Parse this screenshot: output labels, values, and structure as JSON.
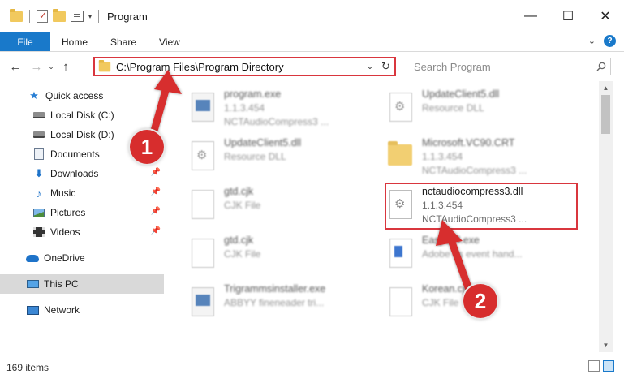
{
  "window": {
    "title": "Program",
    "minimize": "—",
    "maximize": "☐",
    "close": "✕"
  },
  "ribbon": {
    "tabs": [
      "File",
      "Home",
      "Share",
      "View"
    ],
    "expand": "⌄",
    "help": "?"
  },
  "nav": {
    "back": "←",
    "forward": "→",
    "recent": "⌄",
    "up": "↑",
    "address": "C:\\Program Files\\Program Directory",
    "address_dropdown": "⌄",
    "refresh": "↻",
    "search_placeholder": "Search Program"
  },
  "sidebar": {
    "items": [
      {
        "label": "Quick access",
        "icon": "star-icon",
        "pinned": false
      },
      {
        "label": "Local Disk (C:)",
        "icon": "drive-icon",
        "pinned": true
      },
      {
        "label": "Local Disk (D:)",
        "icon": "drive-icon",
        "pinned": true
      },
      {
        "label": "Documents",
        "icon": "documents-icon",
        "pinned": true
      },
      {
        "label": "Downloads",
        "icon": "download-icon",
        "pinned": true
      },
      {
        "label": "Music",
        "icon": "music-icon",
        "pinned": true
      },
      {
        "label": "Pictures",
        "icon": "pictures-icon",
        "pinned": true
      },
      {
        "label": "Videos",
        "icon": "videos-icon",
        "pinned": true
      },
      {
        "label": "OneDrive",
        "icon": "onedrive-icon",
        "pinned": false
      },
      {
        "label": "This PC",
        "icon": "pc-icon",
        "pinned": false,
        "selected": true
      },
      {
        "label": "Network",
        "icon": "network-icon",
        "pinned": false
      }
    ]
  },
  "files": [
    {
      "name": "program.exe",
      "line2": "1.1.3.454",
      "line3": "NCTAudioCompress3   ...",
      "icon": "exe-icon",
      "blurred": true
    },
    {
      "name": "UpdateClient5.dll",
      "line2": "Resource DLL",
      "line3": "",
      "icon": "dll-gear-icon",
      "blurred": true
    },
    {
      "name": "UpdateClient5.dll",
      "line2": "Resource DLL",
      "line3": "",
      "icon": "dll-gear-icon",
      "blurred": true
    },
    {
      "name": "Microsoft.VC90.CRT",
      "line2": "1.1.3.454",
      "line3": "NCTAudioCompress3   ...",
      "icon": "folder-icon",
      "blurred": true
    },
    {
      "name": "gtd.cjk",
      "line2": "CJK File",
      "line3": "",
      "icon": "blank-file-icon",
      "blurred": true
    },
    {
      "name": "nctaudiocompress3.dll",
      "line2": "1.1.3.454",
      "line3": "NCTAudioCompress3   ...",
      "icon": "dll-gear-icon",
      "blurred": false
    },
    {
      "name": "gtd.cjk",
      "line2": "CJK File",
      "line3": "",
      "icon": "blank-file-icon",
      "blurred": true
    },
    {
      "name": "EasySTI.exe",
      "line2": "Adobe ds event hand...",
      "line3": "",
      "icon": "blue-file-icon",
      "blurred": true
    },
    {
      "name": "Trigrammsinstaller.exe",
      "line2": "ABBYY fineneader tri...",
      "line3": "",
      "icon": "exe-icon",
      "blurred": true
    },
    {
      "name": "Korean.cjk",
      "line2": "CJK File",
      "line3": "",
      "icon": "blank-file-icon",
      "blurred": true
    }
  ],
  "status": {
    "count": "169 items"
  },
  "annotations": {
    "callout_1": "1",
    "callout_2": "2",
    "accent": "#d72d2d"
  },
  "colors": {
    "accent": "#1979ca",
    "highlight": "#d9363e"
  }
}
